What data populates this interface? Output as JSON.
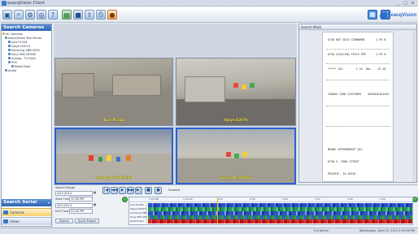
{
  "window": {
    "title": "exacqVision Client",
    "controls": [
      "_",
      "□",
      "×"
    ]
  },
  "toolbar": {
    "buttons": [
      "live-view",
      "search",
      "setup",
      "search-video",
      "help",
      "camera",
      "stop",
      "export",
      "print",
      "record"
    ],
    "logo_text": "exacqVision"
  },
  "sidebar": {
    "title": "Search Cameras",
    "tree": [
      {
        "label": "All Cameras",
        "level": 0,
        "icon": "folder-icon"
      },
      {
        "label": "exacqVision Test Server",
        "level": 1,
        "icon": "server-icon"
      },
      {
        "label": "Axis P1344",
        "level": 2,
        "icon": "camera-icon"
      },
      {
        "label": "IQeye D3070",
        "level": 2,
        "icon": "camera-icon"
      },
      {
        "label": "Samsung SNB-5000",
        "level": 2,
        "icon": "camera-icon"
      },
      {
        "label": "Sony SNC-DH160",
        "level": 2,
        "icon": "camera-icon"
      },
      {
        "label": "Analog - TV Feed",
        "level": 2,
        "icon": "camera-icon"
      },
      {
        "label": "POS",
        "level": 2,
        "icon": "pos-icon"
      },
      {
        "label": "Retail Feed",
        "level": 3,
        "icon": "receipt-icon"
      },
      {
        "label": "Audio",
        "level": 1,
        "icon": "audio-icon"
      }
    ],
    "search_serial_title": "Search Serial",
    "nav": [
      {
        "label": "Cameras",
        "icon": "camera-icon"
      },
      {
        "label": "Views",
        "icon": "views-icon"
      }
    ]
  },
  "cameras": [
    {
      "label": "Axis P1344",
      "active": false
    },
    {
      "label": "IQeye D3070",
      "active": false
    },
    {
      "label": "Samsung SNB-5000",
      "active": true
    },
    {
      "label": "Sony SNC-DH160",
      "active": true
    }
  ],
  "receipt": {
    "panel_title": "Search Mask",
    "lines": [
      "6746 NOT SOLD CINNAMON       1.99 N",
      "6746 SIZZLING TEXIS PEP      1.99 N",
      "***** TAX        1.34  BAL    23.18",
      "CHANGE CARD CUSTOMER    4035016161461",
      "MEANS SUPERMARKET #21",
      "6740 S. PARK STREET",
      "PRAIRIE, IA 56107"
    ]
  },
  "search_range": {
    "title": "Search Range",
    "start_date": "4/21/2014",
    "start_time_label": "Start Time:",
    "start_time": "12:00 PM",
    "end_date": "4/21/2014",
    "end_time_label": "End Time:",
    "end_time": "03:00 PM",
    "search_button": "Search",
    "export_button": "Quick Export"
  },
  "playback": {
    "buttons": [
      "|◀",
      "◀◀",
      "▶",
      "▶▶",
      "▶|",
      "■",
      "●"
    ],
    "direction_label": "Forward"
  },
  "timeline": {
    "tick_labels": [
      "1:00 PM",
      "1:30:00",
      "2:00",
      "2:30",
      "3:00",
      "3:30",
      "4:00",
      "4:30"
    ],
    "cursor_fraction": 0.26,
    "tracks": [
      {
        "name": "Axis P1344"
      },
      {
        "name": "IQeye D3070"
      },
      {
        "name": "Samsung SNB-5000"
      },
      {
        "name": "Sony SNC-DH160"
      },
      {
        "name": "Retail Feed"
      }
    ]
  },
  "status": {
    "user": "Full Admin",
    "datetime": "Wednesday, April 23, 2014 2:55:58 PM"
  }
}
